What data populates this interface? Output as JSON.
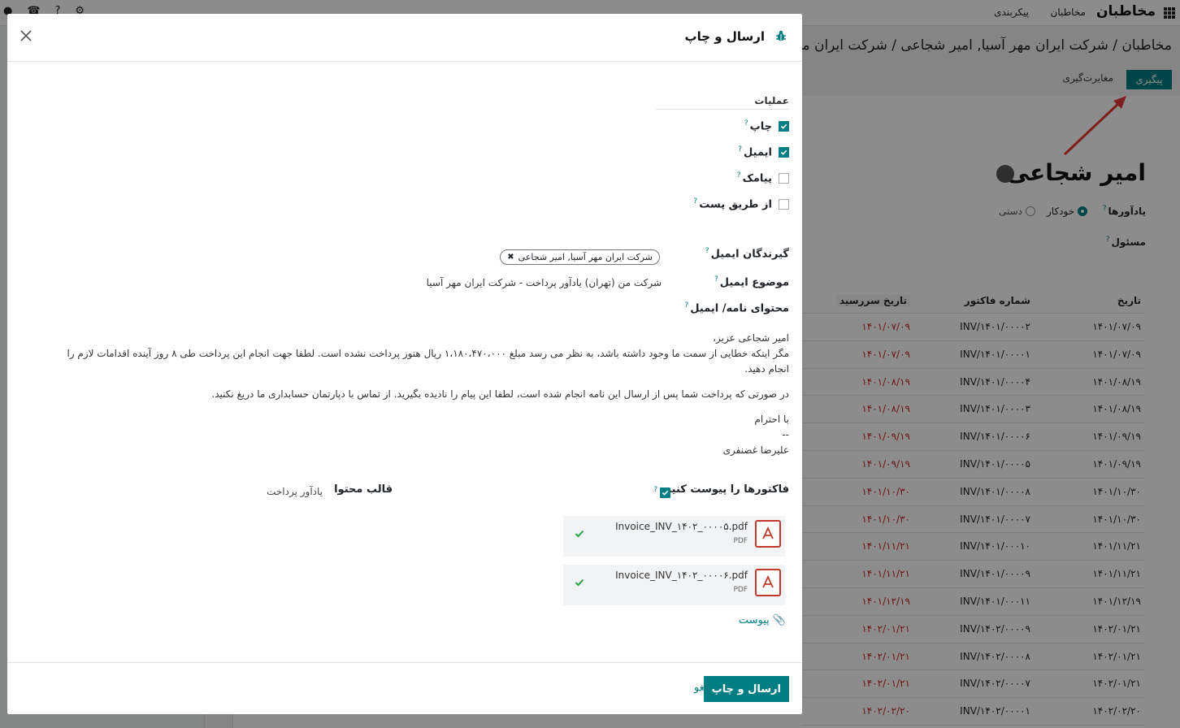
{
  "topbar": {
    "brand": "مخاطبان",
    "menu_contacts": "مخاطبان",
    "menu_config": "پیکربندی"
  },
  "background": {
    "breadcrumb": "مخاطبان / شرکت ایران مهر آسیا, امیر شجاعی / شرکت ایران مهر",
    "followup_button": "پیگیری",
    "reconcile_button": "مغایرت‌گیری",
    "partner_name": "امیر شجاعی",
    "reminders_label": "یادآورها",
    "reminders_auto": "خودکار",
    "reminders_manual": "دستی",
    "responsible_label": "مسئول",
    "table": {
      "headers": {
        "date": "تاریخ",
        "number": "شماره فاکتور",
        "due": "تاریخ سررسید"
      },
      "rows": [
        {
          "date": "۱۴۰۱/۰۷/۰۹",
          "number": "INV/۱۴۰۱/۰۰۰۰۲",
          "due": "۱۴۰۱/۰۷/۰۹"
        },
        {
          "date": "۱۴۰۱/۰۷/۰۹",
          "number": "INV/۱۴۰۱/۰۰۰۰۱",
          "due": "۱۴۰۱/۰۷/۰۹"
        },
        {
          "date": "۱۴۰۱/۰۸/۱۹",
          "number": "INV/۱۴۰۱/۰۰۰۰۴",
          "due": "۱۴۰۱/۰۸/۱۹"
        },
        {
          "date": "۱۴۰۱/۰۸/۱۹",
          "number": "INV/۱۴۰۱/۰۰۰۰۳",
          "due": "۱۴۰۱/۰۸/۱۹"
        },
        {
          "date": "۱۴۰۱/۰۹/۱۹",
          "number": "INV/۱۴۰۱/۰۰۰۰۶",
          "due": "۱۴۰۱/۰۹/۱۹"
        },
        {
          "date": "۱۴۰۱/۰۹/۱۹",
          "number": "INV/۱۴۰۱/۰۰۰۰۵",
          "due": "۱۴۰۱/۰۹/۱۹"
        },
        {
          "date": "۱۴۰۱/۱۰/۳۰",
          "number": "INV/۱۴۰۱/۰۰۰۰۸",
          "due": "۱۴۰۱/۱۰/۳۰"
        },
        {
          "date": "۱۴۰۱/۱۰/۳۰",
          "number": "INV/۱۴۰۱/۰۰۰۰۷",
          "due": "۱۴۰۱/۱۰/۳۰"
        },
        {
          "date": "۱۴۰۱/۱۱/۲۱",
          "number": "INV/۱۴۰۱/۰۰۰۱۰",
          "due": "۱۴۰۱/۱۱/۲۱"
        },
        {
          "date": "۱۴۰۱/۱۱/۲۱",
          "number": "INV/۱۴۰۱/۰۰۰۰۹",
          "due": "۱۴۰۱/۱۱/۲۱"
        },
        {
          "date": "۱۴۰۱/۱۲/۱۹",
          "number": "INV/۱۴۰۱/۰۰۰۱۱",
          "due": "۱۴۰۱/۱۲/۱۹"
        },
        {
          "date": "۱۴۰۲/۰۱/۲۱",
          "number": "INV/۱۴۰۲/۰۰۰۰۹",
          "due": "۱۴۰۲/۰۱/۲۱"
        },
        {
          "date": "۱۴۰۲/۰۱/۲۱",
          "number": "INV/۱۴۰۲/۰۰۰۰۸",
          "due": "۱۴۰۲/۰۱/۲۱"
        },
        {
          "date": "۱۴۰۲/۰۱/۲۱",
          "number": "INV/۱۴۰۲/۰۰۰۰۷",
          "due": "۱۴۰۲/۰۱/۲۱"
        },
        {
          "date": "۱۴۰۲/۰۲/۲۰",
          "number": "INV/۱۴۰۲/۰۰۰۰۱",
          "due": "۱۴۰۲/۰۲/۲۰"
        }
      ]
    }
  },
  "modal": {
    "title": "ارسال و چاپ",
    "section_actions": "عملیات",
    "options": [
      {
        "label": "چاپ",
        "checked": true
      },
      {
        "label": "ایمیل",
        "checked": true
      },
      {
        "label": "پیامک",
        "checked": false
      },
      {
        "label": "از طریق پست",
        "checked": false
      }
    ],
    "help_mark": "?",
    "recipients_label": "گیرندگان ایمیل",
    "recipient_tag": "شرکت ایران مهر آسیا, امیر شجاعی",
    "subject_label": "موضوع ایمیل",
    "subject_value": "شرکت من (تهران) یادآور پرداخت - شرکت ایران مهر آسیا",
    "body_label": "محتوای نامه/ ایمیل",
    "body": {
      "greeting": "امیر شجاعی عزیز،",
      "line1": "مگر اینکه خطایی از سمت ما وجود داشته باشد، به نظر می رسد مبلغ ۱،۱۸۰،۴۷۰،۰۰۰ ریال هنوز پرداخت نشده است. لطفا جهت انجام این پرداخت طی ۸ روز آینده اقدامات لازم را",
      "line2": "انجام دهید.",
      "line3": "در صورتی که پرداخت شما پس از ارسال این نامه انجام شده است، لطفا این پیام را نادیده بگیرید. از تماس با دپارتمان حسابداری ما دریغ نکنید.",
      "regards": "با احترام",
      "dashes": "--",
      "signature": "علیرضا غضنفری"
    },
    "attach_invoices_label": "فاکتورها را پیوست کنید",
    "attach_invoices_checked": true,
    "template_label": "قالب محتوا",
    "template_value": "یادآور پرداخت",
    "files": [
      {
        "name": "Invoice_INV_۱۴۰۲_۰۰۰۰۵.pdf",
        "type": "PDF"
      },
      {
        "name": "Invoice_INV_۱۴۰۲_۰۰۰۰۶.pdf",
        "type": "PDF"
      }
    ],
    "attach_link": "پیوست",
    "send_button": "ارسال و چاپ",
    "cancel_button": "لغو"
  },
  "colors": {
    "primary": "#017e84",
    "overdue": "#c62828",
    "pdf": "#c0392b",
    "arrow": "#e53935"
  }
}
